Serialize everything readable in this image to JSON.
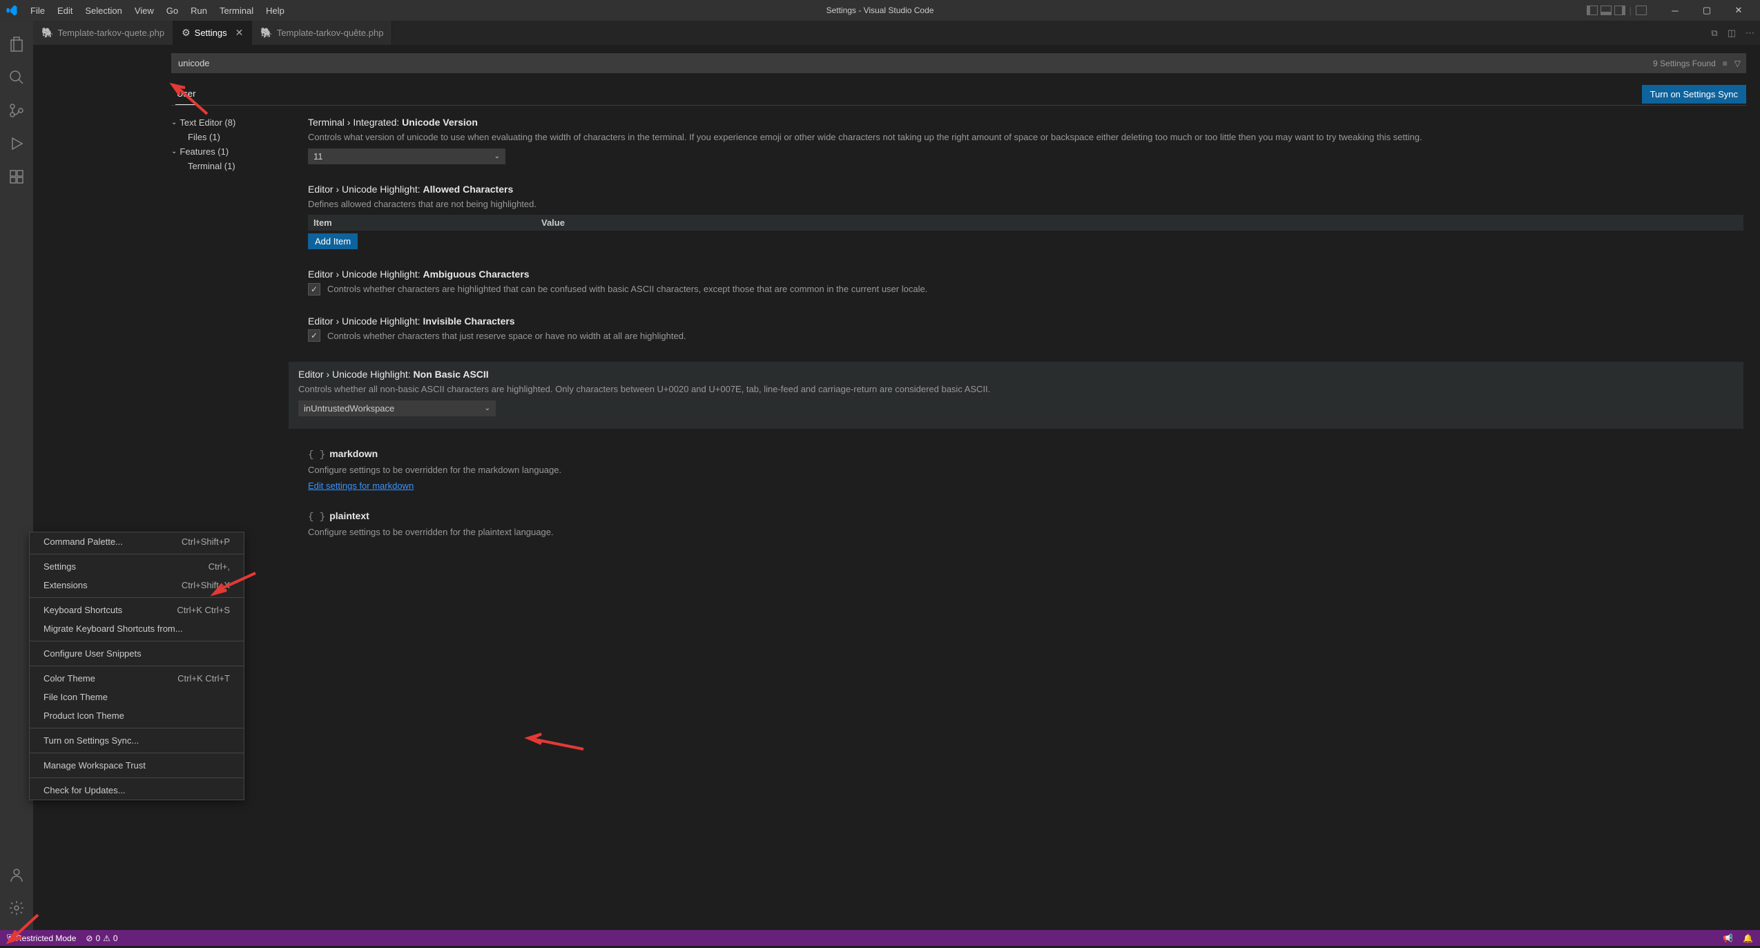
{
  "titlebar": {
    "menu": [
      "File",
      "Edit",
      "Selection",
      "View",
      "Go",
      "Run",
      "Terminal",
      "Help"
    ],
    "title": "Settings - Visual Studio Code"
  },
  "tabs": {
    "items": [
      {
        "label": "Template-tarkov-quete.php",
        "icon": "php",
        "active": false
      },
      {
        "label": "Settings",
        "icon": "settings",
        "active": true,
        "close": true
      },
      {
        "label": "Template-tarkov-quête.php",
        "icon": "php",
        "active": false
      }
    ]
  },
  "search": {
    "value": "unicode",
    "found": "9 Settings Found"
  },
  "scope": {
    "user": "User",
    "sync": "Turn on Settings Sync"
  },
  "toc": {
    "textEditor": "Text Editor (8)",
    "files": "Files (1)",
    "features": "Features (1)",
    "terminal": "Terminal (1)"
  },
  "settings": {
    "unicodeVersion": {
      "prefix": "Terminal › Integrated: ",
      "name": "Unicode Version",
      "desc": "Controls what version of unicode to use when evaluating the width of characters in the terminal. If you experience emoji or other wide characters not taking up the right amount of space or backspace either deleting too much or too little then you may want to try tweaking this setting.",
      "value": "11"
    },
    "allowedChars": {
      "prefix": "Editor › Unicode Highlight: ",
      "name": "Allowed Characters",
      "desc": "Defines allowed characters that are not being highlighted.",
      "col1": "Item",
      "col2": "Value",
      "add": "Add Item"
    },
    "ambiguous": {
      "prefix": "Editor › Unicode Highlight: ",
      "name": "Ambiguous Characters",
      "desc": "Controls whether characters are highlighted that can be confused with basic ASCII characters, except those that are common in the current user locale."
    },
    "invisible": {
      "prefix": "Editor › Unicode Highlight: ",
      "name": "Invisible Characters",
      "desc": "Controls whether characters that just reserve space or have no width at all are highlighted."
    },
    "nonBasic": {
      "prefix": "Editor › Unicode Highlight: ",
      "name": "Non Basic ASCII",
      "desc": "Controls whether all non-basic ASCII characters are highlighted. Only characters between U+0020 and U+007E, tab, line-feed and carriage-return are considered basic ASCII.",
      "value": "inUntrustedWorkspace"
    },
    "markdown": {
      "name": "markdown",
      "desc": "Configure settings to be overridden for the markdown language.",
      "link": "Edit settings for markdown"
    },
    "plaintext": {
      "name": "plaintext",
      "desc": "Configure settings to be overridden for the plaintext language."
    }
  },
  "contextMenu": {
    "items": [
      {
        "label": "Command Palette...",
        "shortcut": "Ctrl+Shift+P"
      },
      null,
      {
        "label": "Settings",
        "shortcut": "Ctrl+,"
      },
      {
        "label": "Extensions",
        "shortcut": "Ctrl+Shift+X"
      },
      null,
      {
        "label": "Keyboard Shortcuts",
        "shortcut": "Ctrl+K Ctrl+S"
      },
      {
        "label": "Migrate Keyboard Shortcuts from...",
        "shortcut": ""
      },
      null,
      {
        "label": "Configure User Snippets",
        "shortcut": ""
      },
      null,
      {
        "label": "Color Theme",
        "shortcut": "Ctrl+K Ctrl+T"
      },
      {
        "label": "File Icon Theme",
        "shortcut": ""
      },
      {
        "label": "Product Icon Theme",
        "shortcut": ""
      },
      null,
      {
        "label": "Turn on Settings Sync...",
        "shortcut": ""
      },
      null,
      {
        "label": "Manage Workspace Trust",
        "shortcut": ""
      },
      null,
      {
        "label": "Check for Updates...",
        "shortcut": ""
      }
    ]
  },
  "statusbar": {
    "restricted": "Restricted Mode",
    "errors": "0",
    "warnings": "0"
  }
}
